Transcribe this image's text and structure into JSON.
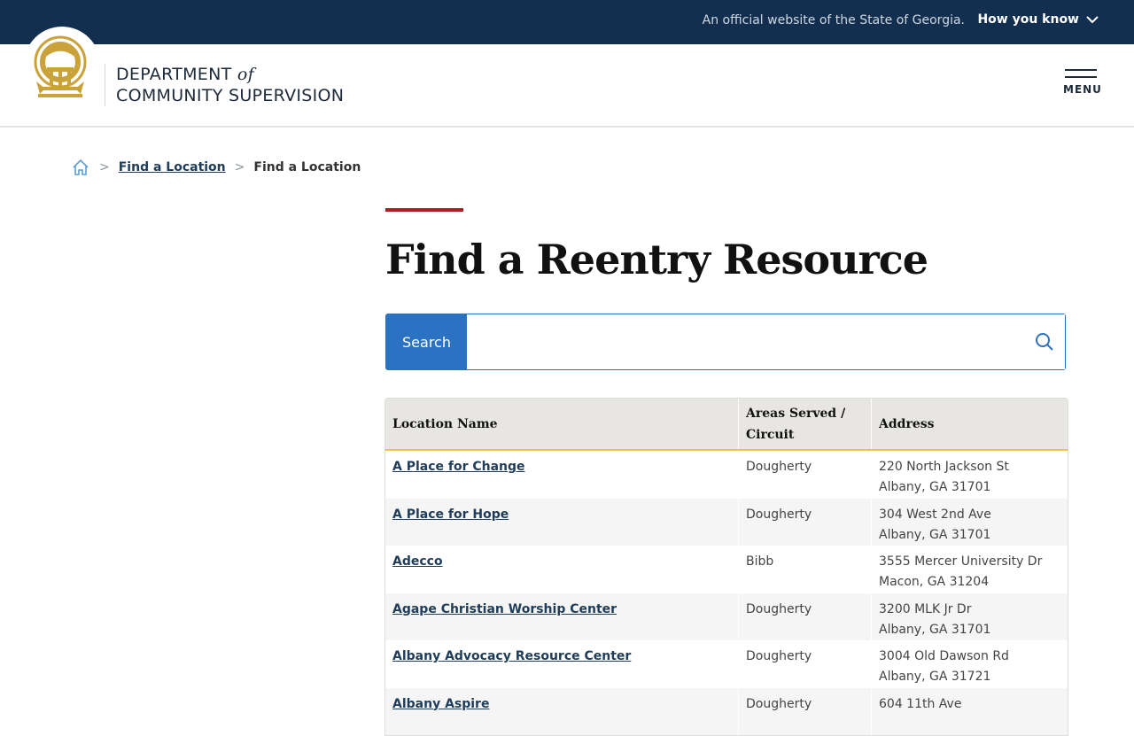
{
  "topbar": {
    "official_text": "An official website of the State of Georgia.",
    "how_you_know": "How you know"
  },
  "header": {
    "dept_line1": "DEPARTMENT",
    "dept_of": "of",
    "dept_line2": "COMMUNITY SUPERVISION",
    "menu_label": "MENU"
  },
  "breadcrumb": {
    "items": [
      "Find a Location",
      "Find a Location"
    ]
  },
  "page": {
    "title": "Find a Reentry Resource"
  },
  "search": {
    "button_label": "Search",
    "value": "",
    "placeholder": ""
  },
  "table": {
    "headers": [
      "Location Name",
      "Areas Served / Circuit",
      "Address"
    ],
    "rows": [
      {
        "name": "A Place for Change",
        "area": "Dougherty",
        "addr1": "220 North Jackson St",
        "addr2": "Albany, GA 31701"
      },
      {
        "name": "A Place for Hope",
        "area": "Dougherty",
        "addr1": "304 West 2nd Ave",
        "addr2": "Albany, GA 31701"
      },
      {
        "name": "Adecco",
        "area": "Bibb",
        "addr1": "3555 Mercer University Dr",
        "addr2": "Macon, GA 31204"
      },
      {
        "name": "Agape Christian Worship Center",
        "area": "Dougherty",
        "addr1": "3200 MLK Jr Dr",
        "addr2": "Albany, GA 31701"
      },
      {
        "name": "Albany Advocacy Resource Center",
        "area": "Dougherty",
        "addr1": "3004 Old Dawson Rd",
        "addr2": "Albany, GA 31721"
      },
      {
        "name": "Albany Aspire",
        "area": "Dougherty",
        "addr1": "604 11th Ave",
        "addr2": ""
      }
    ]
  },
  "colors": {
    "navy": "#132f50",
    "accent_red": "#a81f24",
    "search_blue": "#2c72c2",
    "gold": "#c9a23a"
  }
}
